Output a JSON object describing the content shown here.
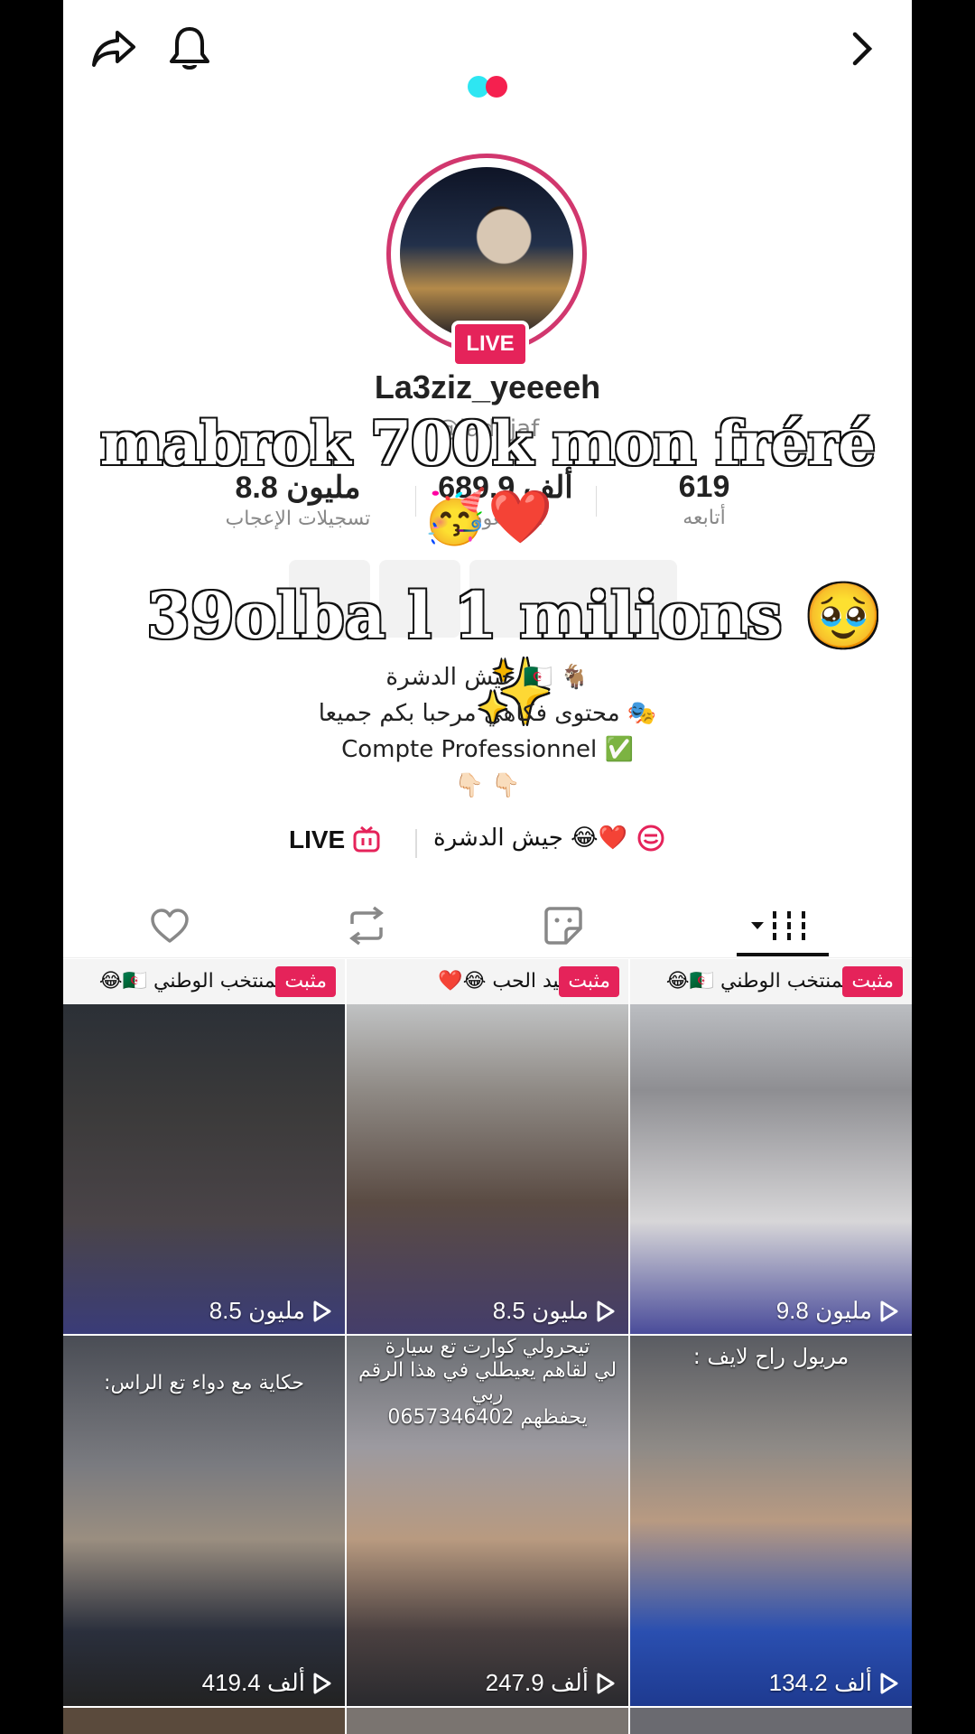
{
  "profile": {
    "username": "La3ziz_yeeeeh",
    "handle": "@laddjaf",
    "live_label": "LIVE"
  },
  "stats": [
    {
      "value": "8.8 مليون",
      "label": "تسجيلات الإعجاب"
    },
    {
      "value": "689.9 ألف",
      "label": "المتابعون"
    },
    {
      "value": "619",
      "label": "أتابعه"
    }
  ],
  "overlay": {
    "line1": "mabrok 700k mon fréré",
    "emojis": "🥳❤️",
    "line2": "39olba l 1 milions 🥹✨"
  },
  "bio": [
    "جيش الدشرة 🇩🇿 🐐",
    "محتوى فكاهي مرحبا بكم جميعا 🎭",
    "Compte Professionnel ✅",
    "👇🏻 👇🏻"
  ],
  "links": {
    "live": "LIVE",
    "group": "جيش الدشرة 😂❤️"
  },
  "tabs": [
    "liked-tab",
    "reposts-tab",
    "favorites-tab",
    "videos-tab"
  ],
  "videos": [
    {
      "pinned": "مثبت",
      "title": "أغنية المنتخب الوطني 🇩🇿😂",
      "views": "8.5 مليون",
      "caption": ""
    },
    {
      "pinned": "مثبت",
      "title": "أغنية عيد الحب 😂❤️",
      "views": "8.5 مليون",
      "caption": ""
    },
    {
      "pinned": "مثبت",
      "title": "أغنية المنتخب الوطني 🇩🇿😂",
      "views": "9.8 مليون",
      "caption": ""
    },
    {
      "pinned": "",
      "title": "",
      "views": "419.4 ألف",
      "caption": "حكاية مع دواء تع الراس:"
    },
    {
      "pinned": "",
      "title": "",
      "views": "247.9 ألف",
      "caption": "تيحرولي كوارت تع سيارة\nلي لقاهم يعيطلي في هذا الرقم ربي\nيحفظهم 0657346402"
    },
    {
      "pinned": "",
      "title": "",
      "views": "134.2 ألف",
      "caption": "مريول راح لايف :"
    }
  ],
  "colors": {
    "accent": "#e5235a",
    "ring": "#d1376e",
    "loader_cyan": "#2ee6f2",
    "loader_red": "#f5204f"
  }
}
